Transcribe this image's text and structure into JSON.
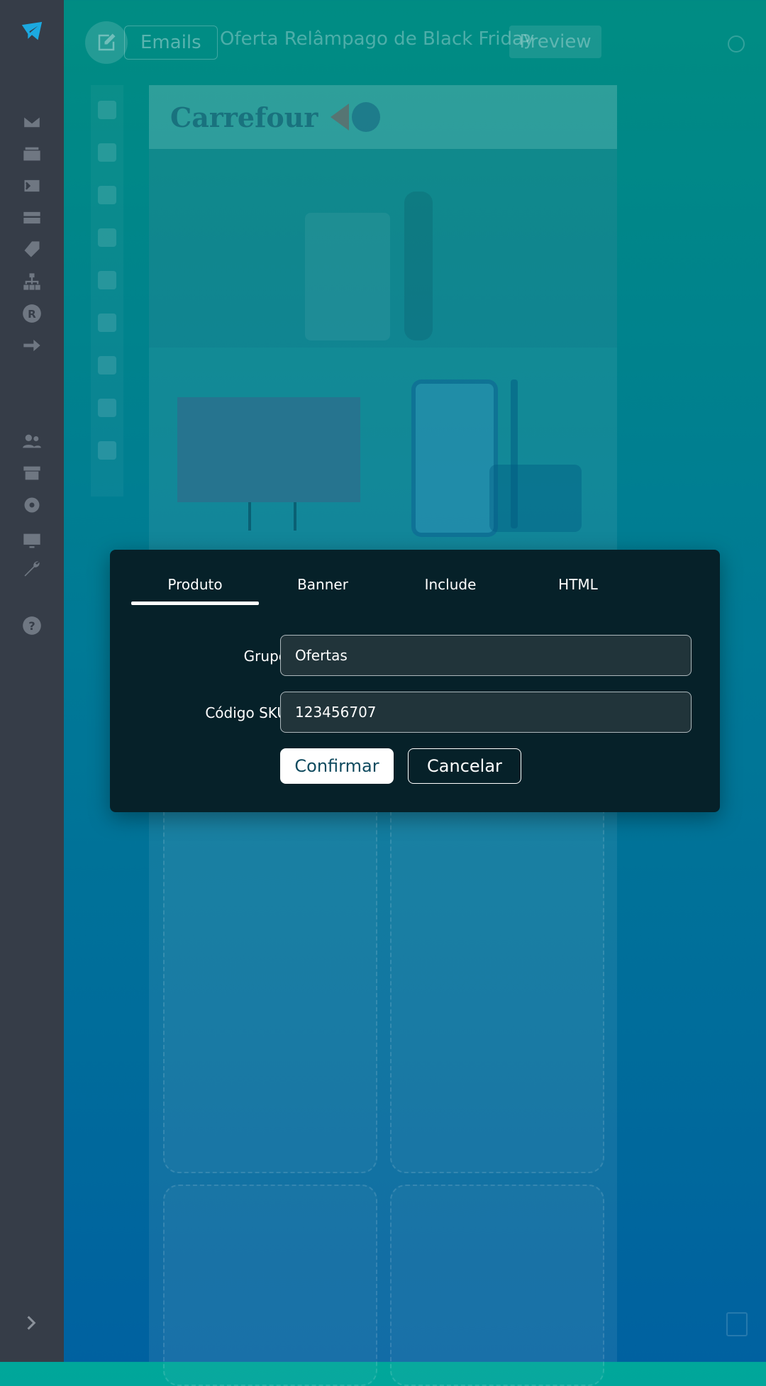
{
  "sidebar": {
    "icons": [
      "logo-icon",
      "mail-icon",
      "mail-settings-icon",
      "terminal-icon",
      "layout-icon",
      "tag-icon",
      "sitemap-icon",
      "registered-icon",
      "redirect-icon",
      "users-icon",
      "store-icon",
      "gear-icon",
      "monitor-icon",
      "wrench-icon",
      "help-icon"
    ],
    "registered_letter": "R",
    "help_glyph": "?"
  },
  "topbar": {
    "breadcrumb": "Emails",
    "title": "Oferta Relâmpago de Black Friday",
    "preview_label": "Preview"
  },
  "email": {
    "brand": "Carrefour"
  },
  "modal": {
    "tabs": [
      {
        "label": "Produto",
        "active": true
      },
      {
        "label": "Banner",
        "active": false
      },
      {
        "label": "Include",
        "active": false
      },
      {
        "label": "HTML",
        "active": false
      }
    ],
    "fields": {
      "grupo_label": "Grupo",
      "grupo_value": "Ofertas",
      "sku_label": "Código SKU",
      "sku_value": "123456707"
    },
    "confirm_label": "Confirmar",
    "cancel_label": "Cancelar"
  },
  "colors": {
    "sidebar_bg": "#363d48",
    "modal_bg": "#062129",
    "accent": "#1ca9e0",
    "bg_top": "#00a79a",
    "bg_bottom": "#0072bd"
  }
}
